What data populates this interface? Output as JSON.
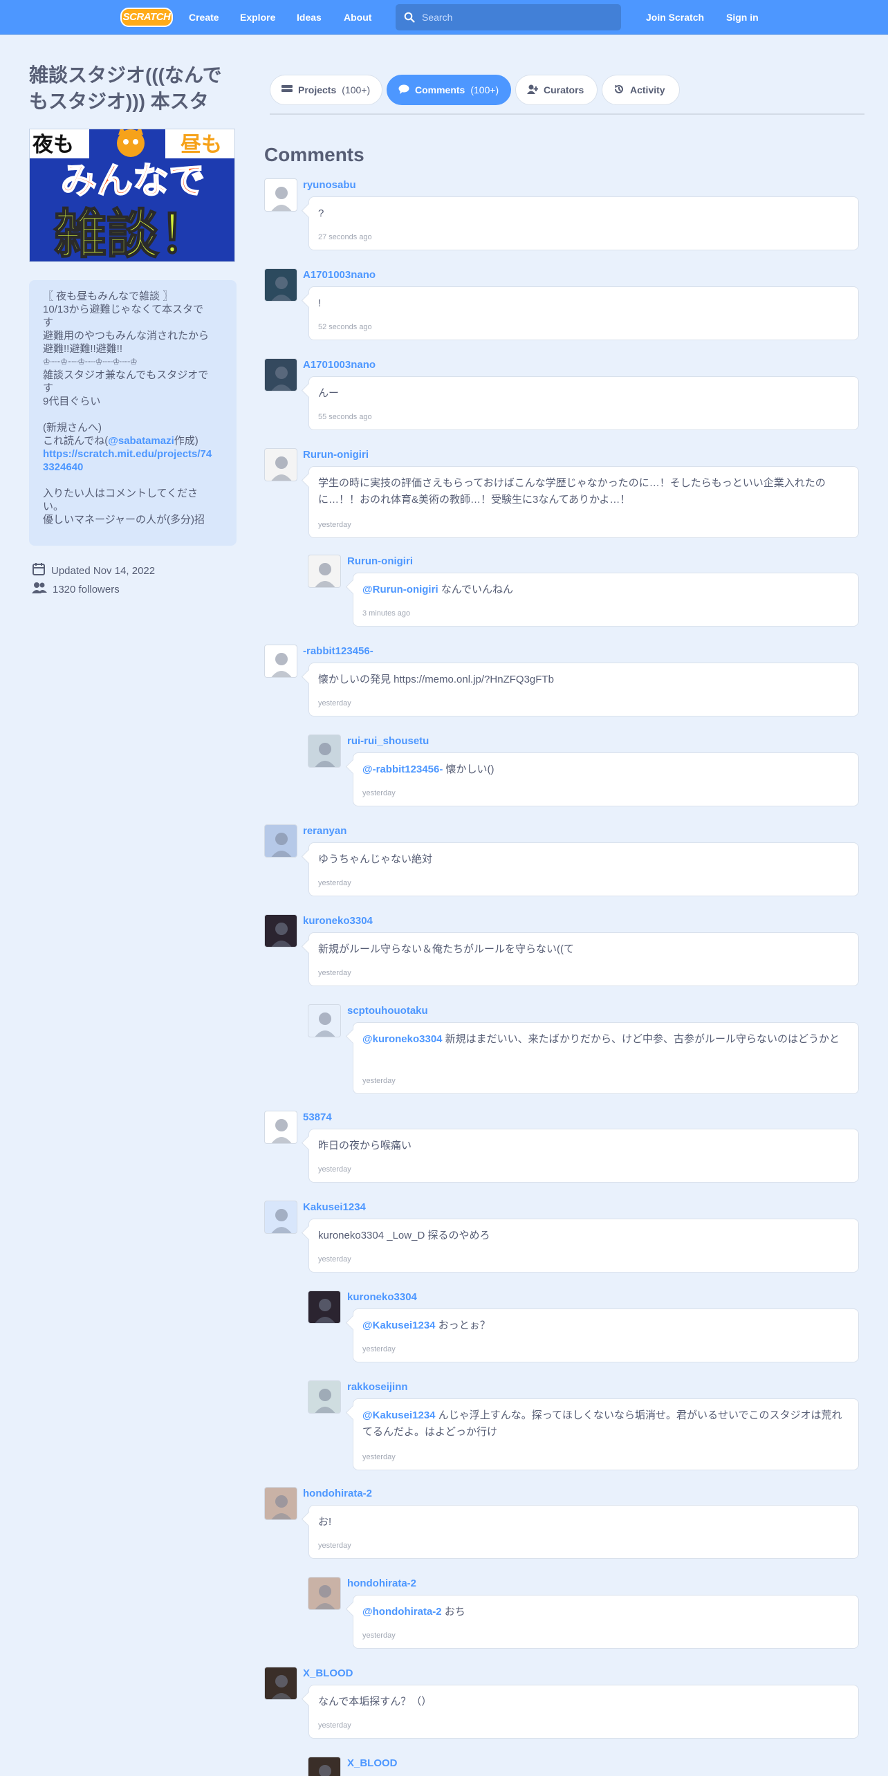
{
  "nav": {
    "logo": "SCRATCH",
    "links": [
      "Create",
      "Explore",
      "Ideas",
      "About"
    ],
    "search_placeholder": "Search",
    "join": "Join Scratch",
    "signin": "Sign in"
  },
  "studio": {
    "title": "雑談スタジオ(((なんでもスタジオ))) 本スタ",
    "thumbnail_text": {
      "a": "夜も",
      "b": "昼も",
      "c": "みんなで",
      "d": "雑談！"
    },
    "description_lines": [
      "〖 夜も昼もみんなで雑談 〗",
      "10/13から避難じゃなくて本スタで",
      "す",
      "避難用のやつもみんな消されたから",
      "避難!!避難!!避難!!",
      "♔┈┈♔┈┈♔┈┈♔┈┈♔┈┈♔",
      "雑談スタジオ兼なんでもスタジオで",
      "す",
      "9代目ぐらい",
      "",
      "(新規さんへ)",
      "これ読んでね(",
      "https://scratch.mit.edu/projects/74",
      "3324640",
      "",
      "入りたい人はコメントしてくださ",
      "い。",
      "優しいマネージャーの人が(多分)招"
    ],
    "description_mention": "@sabatamazi",
    "description_mention_suffix": "作成)",
    "updated": "Updated Nov 14, 2022",
    "followers": "1320 followers"
  },
  "tabs": [
    {
      "label": "Projects",
      "count": "(100+)"
    },
    {
      "label": "Comments",
      "count": "(100+)"
    },
    {
      "label": "Curators",
      "count": ""
    },
    {
      "label": "Activity",
      "count": ""
    }
  ],
  "comments_title": "Comments",
  "comments": [
    {
      "user": "ryunosabu",
      "text": "?",
      "time": "27 seconds ago",
      "reply": false
    },
    {
      "user": "A1701003nano",
      "text": "!",
      "time": "52 seconds ago",
      "reply": false
    },
    {
      "user": "A1701003nano",
      "text": "んー",
      "time": "55 seconds ago",
      "reply": false
    },
    {
      "user": "Rurun-onigiri",
      "text": "学生の時に実技の評価さえもらっておけばこんな学歴じゃなかったのに…！そしたらもっといい企業入れたのに…！！おのれ体育&美術の教師…！受験生に3なんてありかよ…！",
      "time": "yesterday",
      "reply": false
    },
    {
      "user": "Rurun-onigiri",
      "mention": "@Rurun-onigiri",
      "text": " なんでいんねん",
      "time": "3 minutes ago",
      "reply": true
    },
    {
      "user": "-rabbit123456-",
      "text": "懐かしいの発見 https://memo.onl.jp/?HnZFQ3gFTb",
      "time": "yesterday",
      "reply": false
    },
    {
      "user": "rui-rui_shousetu",
      "mention": "@-rabbit123456-",
      "text": " 懐かしい()",
      "time": "yesterday",
      "reply": true
    },
    {
      "user": "reranyan",
      "text": "ゆうちゃんじゃない絶対",
      "time": "yesterday",
      "reply": false
    },
    {
      "user": "kuroneko3304",
      "text": "新規がルール守らない＆俺たちがルールを守らない((て",
      "time": "yesterday",
      "reply": false
    },
    {
      "user": "scptouhouotaku",
      "mention": "@kuroneko3304",
      "text": " 新規はまだいい、来たばかりだから、けど中参、古参がルール守らないのはどうかと",
      "time": "yesterday",
      "reply": true
    },
    {
      "user": "53874",
      "text": "昨日の夜から喉痛い",
      "time": "yesterday",
      "reply": false
    },
    {
      "user": "Kakusei1234",
      "text": "kuroneko3304 _Low_D 探るのやめろ",
      "time": "yesterday",
      "reply": false
    },
    {
      "user": "kuroneko3304",
      "mention": "@Kakusei1234",
      "text": " おっとぉ？",
      "time": "yesterday",
      "reply": true
    },
    {
      "user": "rakkoseijinn",
      "mention": "@Kakusei1234",
      "text": " んじゃ浮上すんな。探ってほしくないなら垢消せ。君がいるせいでこのスタジオは荒れてるんだよ。はよどっか行け",
      "time": "yesterday",
      "reply": true
    },
    {
      "user": "hondohirata-2",
      "text": "お!",
      "time": "yesterday",
      "reply": false
    },
    {
      "user": "hondohirata-2",
      "mention": "@hondohirata-2",
      "text": " おち",
      "time": "yesterday",
      "reply": true
    },
    {
      "user": "X_BLOOD",
      "text": "なんで本垢探すん？（）",
      "time": "yesterday",
      "reply": false
    },
    {
      "user": "X_BLOOD",
      "text": "",
      "time": "",
      "reply": true
    }
  ],
  "colors": {
    "nav": "#4d97ff",
    "link": "#4d97ff",
    "background": "#e9f1fc",
    "logo": "#ffab19"
  },
  "icons": [
    "search-icon",
    "calendar-icon",
    "followers-icon",
    "projects-icon",
    "comments-icon",
    "curators-icon",
    "activity-icon"
  ]
}
